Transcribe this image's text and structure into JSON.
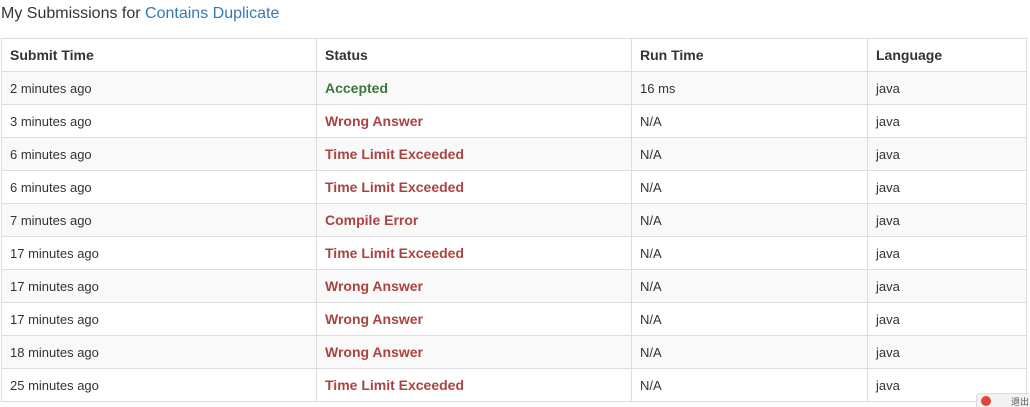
{
  "heading": {
    "prefix": "My Submissions for ",
    "problem_link": "Contains Duplicate"
  },
  "columns": [
    "Submit Time",
    "Status",
    "Run Time",
    "Language"
  ],
  "rows": [
    {
      "submit_time": "2 minutes ago",
      "status": "Accepted",
      "status_type": "ok",
      "run_time": "16 ms",
      "language": "java"
    },
    {
      "submit_time": "3 minutes ago",
      "status": "Wrong Answer",
      "status_type": "bad",
      "run_time": "N/A",
      "language": "java"
    },
    {
      "submit_time": "6 minutes ago",
      "status": "Time Limit Exceeded",
      "status_type": "bad",
      "run_time": "N/A",
      "language": "java"
    },
    {
      "submit_time": "6 minutes ago",
      "status": "Time Limit Exceeded",
      "status_type": "bad",
      "run_time": "N/A",
      "language": "java"
    },
    {
      "submit_time": "7 minutes ago",
      "status": "Compile Error",
      "status_type": "bad",
      "run_time": "N/A",
      "language": "java"
    },
    {
      "submit_time": "17 minutes ago",
      "status": "Time Limit Exceeded",
      "status_type": "bad",
      "run_time": "N/A",
      "language": "java"
    },
    {
      "submit_time": "17 minutes ago",
      "status": "Wrong Answer",
      "status_type": "bad",
      "run_time": "N/A",
      "language": "java"
    },
    {
      "submit_time": "17 minutes ago",
      "status": "Wrong Answer",
      "status_type": "bad",
      "run_time": "N/A",
      "language": "java"
    },
    {
      "submit_time": "18 minutes ago",
      "status": "Wrong Answer",
      "status_type": "bad",
      "run_time": "N/A",
      "language": "java"
    },
    {
      "submit_time": "25 minutes ago",
      "status": "Time Limit Exceeded",
      "status_type": "bad",
      "run_time": "N/A",
      "language": "java"
    }
  ],
  "corner_widget": {
    "label": "退出",
    "icon": "logout-icon"
  },
  "colors": {
    "link": "#337ab7",
    "accepted": "#3c763d",
    "error": "#a94442",
    "border": "#dddddd",
    "stripe": "#f9f9f9"
  }
}
